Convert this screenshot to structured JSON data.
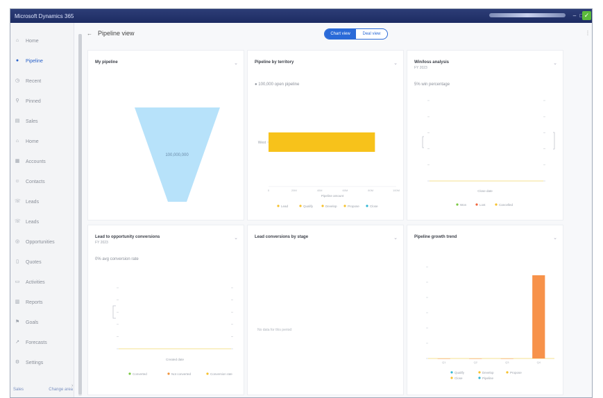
{
  "window": {
    "title": "Microsoft Dynamics 365",
    "minimize": "–",
    "maximize": "□",
    "close": "✓"
  },
  "sidebar": {
    "items": [
      {
        "label": "Home",
        "icon": "home-icon",
        "glyph": "⌂"
      },
      {
        "label": "Pipeline",
        "icon": "dashboard-icon",
        "glyph": "●"
      },
      {
        "label": "Recent",
        "icon": "clock-icon",
        "glyph": "◷"
      },
      {
        "label": "Pinned",
        "icon": "pin-icon",
        "glyph": "⚲"
      },
      {
        "label": "Sales",
        "icon": "chart-icon",
        "glyph": "▤"
      },
      {
        "label": "Home",
        "icon": "home-icon",
        "glyph": "⌂"
      },
      {
        "label": "Accounts",
        "icon": "building-icon",
        "glyph": "▦"
      },
      {
        "label": "Contacts",
        "icon": "person-icon",
        "glyph": "☺"
      },
      {
        "label": "Leads",
        "icon": "phone-icon",
        "glyph": "☏"
      },
      {
        "label": "Leads",
        "icon": "phone-icon",
        "glyph": "☏"
      },
      {
        "label": "Opportunities",
        "icon": "target-icon",
        "glyph": "◎"
      },
      {
        "label": "Quotes",
        "icon": "document-icon",
        "glyph": "▯"
      },
      {
        "label": "Activities",
        "icon": "calendar-icon",
        "glyph": "▭"
      },
      {
        "label": "Reports",
        "icon": "report-icon",
        "glyph": "▥"
      },
      {
        "label": "Goals",
        "icon": "flag-icon",
        "glyph": "⚑"
      },
      {
        "label": "Forecasts",
        "icon": "forecast-icon",
        "glyph": "↗"
      },
      {
        "label": "Settings",
        "icon": "gear-icon",
        "glyph": "⚙"
      }
    ],
    "collapse_glyph": "›",
    "footer_left": "Sales",
    "footer_right": "Change area"
  },
  "header": {
    "back_glyph": "←",
    "title": "Pipeline view",
    "toggle": [
      "Chart view",
      "Deal view"
    ],
    "right_glyph": "⋮"
  },
  "cards": {
    "funnel": {
      "title": "My pipeline",
      "label": "100,000,000"
    },
    "territory": {
      "title": "Pipeline by territory",
      "note": "● 100,000 open pipeline",
      "y_label": "West",
      "x_label": "Pipeline amount",
      "ticks": [
        "0",
        "20M",
        "40M",
        "60M",
        "80M",
        "100M"
      ],
      "legend": [
        "Lead",
        "Qualify",
        "Develop",
        "Propose",
        "Close"
      ],
      "legend_colors": [
        "#f6c12c",
        "#f6c12c",
        "#f6c12c",
        "#f6c12c",
        "#2fb6d4"
      ]
    },
    "winloss": {
      "title": "Win/loss analysis",
      "subtitle": "FY 2023",
      "note": "5% win percentage",
      "legend": [
        "Won",
        "Lost",
        "Cancelled"
      ],
      "legend_colors": [
        "#7ac943",
        "#f0643c",
        "#f6c12c"
      ],
      "x_label": "Close date"
    },
    "conversions": {
      "title": "Lead to opportunity conversions",
      "subtitle": "FY 2023",
      "note": "0% avg conversion rate",
      "legend": [
        "Converted",
        "Not converted",
        "Conversion rate"
      ],
      "legend_colors": [
        "#7ac943",
        "#f0943c",
        "#f6c12c"
      ],
      "x_label": "Created date"
    },
    "stage": {
      "title": "Lead conversions by stage",
      "note": "No data for this period"
    },
    "growth": {
      "title": "Pipeline growth trend",
      "legend": [
        "Qualify",
        "Develop",
        "Propose",
        "Close",
        "Pipeline"
      ],
      "legend_colors": [
        "#2fb6d4",
        "#f6c12c",
        "#f6c12c",
        "#f6c12c",
        "#2fb6d4"
      ]
    }
  },
  "chart_data": [
    {
      "type": "bar",
      "title": "Pipeline by territory",
      "categories": [
        "West"
      ],
      "values": [
        100
      ],
      "ylim": [
        0,
        100
      ],
      "color": "#f7c21b"
    },
    {
      "type": "bar",
      "title": "Pipeline growth trend",
      "categories": [
        "Q1",
        "Q2",
        "Q3",
        "Q4"
      ],
      "values": [
        0,
        0,
        0,
        100
      ],
      "ylim": [
        0,
        110
      ],
      "color": "#f7924a"
    }
  ]
}
